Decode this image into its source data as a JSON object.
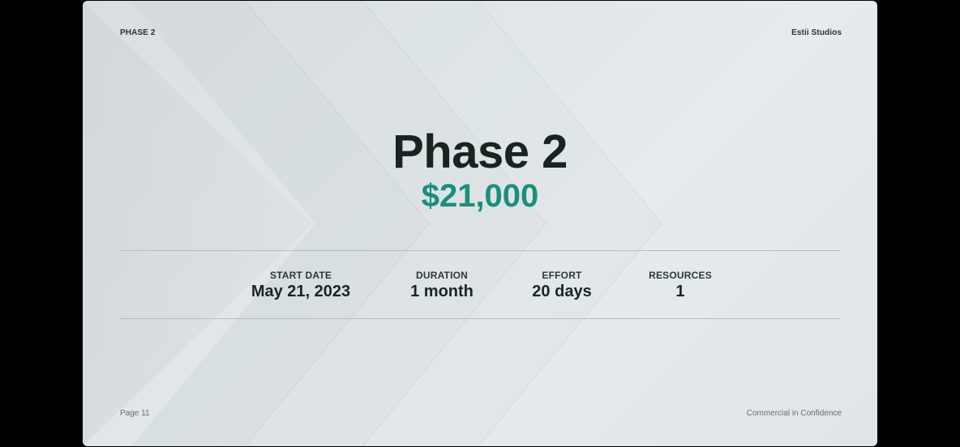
{
  "header": {
    "section_label": "PHASE 2",
    "company": "Estii Studios"
  },
  "hero": {
    "title": "Phase 2",
    "price": "$21,000"
  },
  "stats": [
    {
      "label": "START DATE",
      "value": "May 21, 2023"
    },
    {
      "label": "DURATION",
      "value": "1 month"
    },
    {
      "label": "EFFORT",
      "value": "20 days"
    },
    {
      "label": "RESOURCES",
      "value": "1"
    }
  ],
  "footer": {
    "page": "Page 11",
    "confidentiality": "Commercial in Confidence"
  },
  "colors": {
    "accent": "#1a8f7c",
    "title": "#172420",
    "background": "#e2e8eb"
  }
}
